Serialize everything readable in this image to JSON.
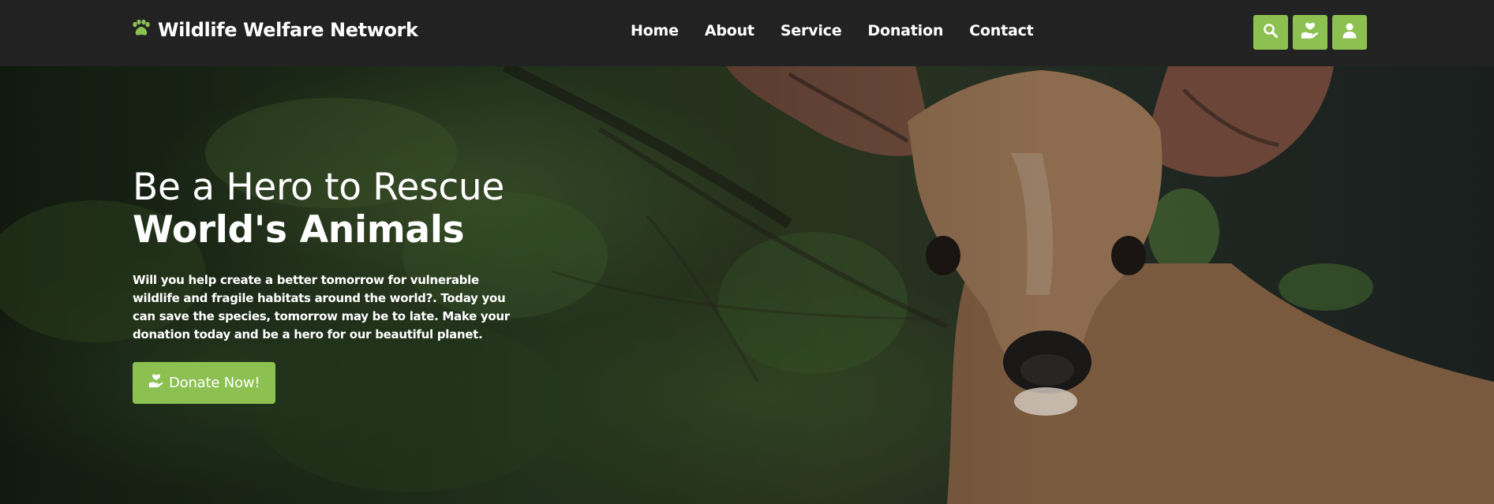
{
  "header": {
    "brand_icon": "paw-icon",
    "brand_name": "Wildlife Welfare Network",
    "nav": [
      {
        "label": "Home"
      },
      {
        "label": "About"
      },
      {
        "label": "Service"
      },
      {
        "label": "Donation"
      },
      {
        "label": "Contact"
      }
    ],
    "actions": [
      {
        "icon": "search-icon"
      },
      {
        "icon": "donate-hand-heart-icon"
      },
      {
        "icon": "user-icon"
      }
    ]
  },
  "hero": {
    "title_line1": "Be a Hero to Rescue",
    "title_line2": "World's Animals",
    "description": "Will you help create a better tomorrow for vulnerable wildlife and fragile habitats around the world?. Today you can save the species, tomorrow may be to late. Make your donation today and be a hero for our beautiful planet.",
    "cta_label": "Donate Now!",
    "cta_icon": "donate-hand-heart-icon",
    "image_subject": "deer-photo"
  },
  "colors": {
    "accent": "#8cc152",
    "header_bg": "#222222",
    "text": "#ffffff"
  }
}
